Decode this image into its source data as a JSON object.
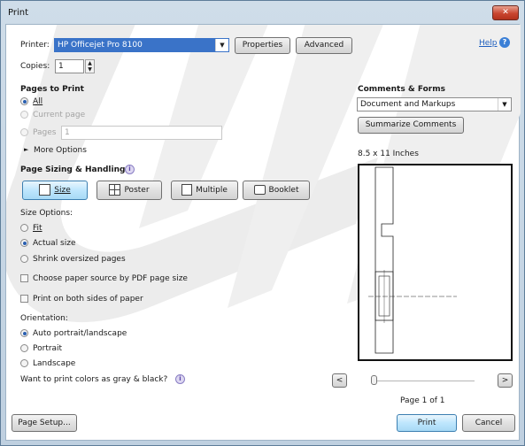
{
  "window": {
    "title": "Print",
    "close_icon": "close-icon"
  },
  "printer": {
    "label": "Printer:",
    "selected": "HP Officejet Pro 8100",
    "properties_label": "Properties",
    "advanced_label": "Advanced",
    "help_label": "Help"
  },
  "copies": {
    "label": "Copies:",
    "value": "1"
  },
  "pages_to_print": {
    "heading": "Pages to Print",
    "all_label": "All",
    "current_page_label": "Current page",
    "pages_label": "Pages",
    "pages_value": "1",
    "more_options_label": "More Options"
  },
  "page_sizing": {
    "heading": "Page Sizing & Handling",
    "size_label": "Size",
    "poster_label": "Poster",
    "multiple_label": "Multiple",
    "booklet_label": "Booklet",
    "size_options_label": "Size Options:",
    "fit_label": "Fit",
    "actual_size_label": "Actual size",
    "shrink_label": "Shrink oversized pages",
    "choose_paper_label": "Choose paper source by PDF page size",
    "both_sides_label": "Print on both sides of paper"
  },
  "orientation": {
    "heading": "Orientation:",
    "auto_label": "Auto portrait/landscape",
    "portrait_label": "Portrait",
    "landscape_label": "Landscape"
  },
  "gray_question": "Want to print colors as gray & black?",
  "comments": {
    "heading": "Comments & Forms",
    "selected": "Document and Markups",
    "summarize_label": "Summarize Comments"
  },
  "preview": {
    "paper_size": "8.5 x 11 Inches",
    "page_indicator": "Page 1 of 1",
    "prev_label": "<",
    "next_label": ">"
  },
  "footer": {
    "page_setup_label": "Page Setup...",
    "print_label": "Print",
    "cancel_label": "Cancel"
  },
  "colors": {
    "accent": "#3399ff",
    "selection": "#3a73c8",
    "link": "#1f5fbf"
  }
}
